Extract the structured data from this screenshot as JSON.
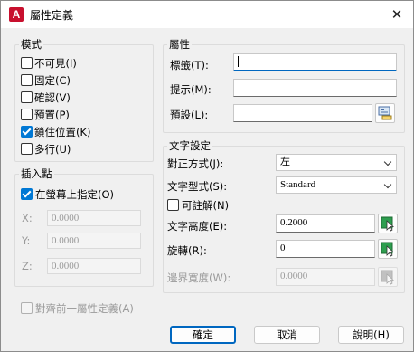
{
  "window": {
    "title": "屬性定義",
    "app_icon": "A"
  },
  "mode": {
    "legend": "模式",
    "options": [
      {
        "label": "不可見(I)",
        "checked": false
      },
      {
        "label": "固定(C)",
        "checked": false
      },
      {
        "label": "確認(V)",
        "checked": false
      },
      {
        "label": "預置(P)",
        "checked": false
      },
      {
        "label": "鎖住位置(K)",
        "checked": true
      },
      {
        "label": "多行(U)",
        "checked": false
      }
    ]
  },
  "insertion": {
    "legend": "插入點",
    "specify_on_screen": {
      "label": "在螢幕上指定(O)",
      "checked": true
    },
    "x": {
      "label": "X:",
      "value": "0.0000"
    },
    "y": {
      "label": "Y:",
      "value": "0.0000"
    },
    "z": {
      "label": "Z:",
      "value": "0.0000"
    }
  },
  "attribute": {
    "legend": "屬性",
    "tag": {
      "label": "標籤(T):",
      "value": ""
    },
    "prompt": {
      "label": "提示(M):",
      "value": ""
    },
    "default": {
      "label": "預設(L):",
      "value": ""
    }
  },
  "text_settings": {
    "legend": "文字設定",
    "justification": {
      "label": "對正方式(J):",
      "value": "左"
    },
    "text_style": {
      "label": "文字型式(S):",
      "value": "Standard"
    },
    "annotative": {
      "label": "可註解(N)",
      "checked": false
    },
    "text_height": {
      "label": "文字高度(E):",
      "value": "0.2000"
    },
    "rotation": {
      "label": "旋轉(R):",
      "value": "0"
    },
    "boundary_width": {
      "label": "邊界寬度(W):",
      "value": "0.0000"
    }
  },
  "align_below": {
    "label": "對齊前一屬性定義(A)",
    "checked": false
  },
  "buttons": {
    "ok": "確定",
    "cancel": "取消",
    "help": "說明(H)"
  }
}
